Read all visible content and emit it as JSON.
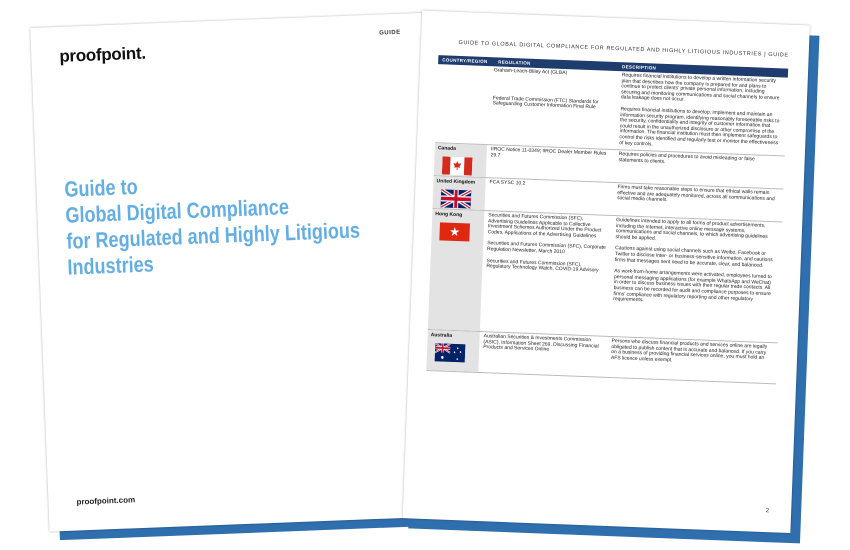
{
  "cover": {
    "logo": "proofpoint.",
    "label": "GUIDE",
    "title_lines": [
      "Guide to",
      "Global Digital Compliance",
      "for Regulated and Highly Litigious",
      "Industries"
    ],
    "url": "proofpoint.com"
  },
  "page": {
    "header": "GUIDE TO GLOBAL DIGITAL COMPLIANCE FOR REGULATED AND HIGHLY LITIGIOUS INDUSTRIES  |  GUIDE",
    "columns": [
      "COUNTRY/REGION",
      "REGULATION",
      "DESCRIPTION"
    ],
    "page_number": "2",
    "rows": [
      {
        "country": "",
        "regulations": [
          "Graham-Leach-Bliley Act (GLBA)",
          "Federal Trade Commission (FTC) Standards for Safeguarding Customer Information Final Rule"
        ],
        "descriptions": [
          "Requires financial institutions to develop a written information security plan that describes how the company is prepared for and plans to continue to protect clients' private personal information, including securing and monitoring communications and social channels to ensure data leakage does not occur.",
          "Requires financial institutions to develop, implement and maintain an information security program, identifying reasonably foreseeable risks to the security, confidentiality and integrity of customer information that could result in the unauthorized disclosure or other compromise of the information. The financial institution must then implement safeguards to control the risks identified and regularly test or monitor the effectiveness of key controls."
        ]
      },
      {
        "country": "Canada",
        "regulations": [
          "IIROC Notice 11-0349; IIROC Dealer Member Rules 29.7"
        ],
        "descriptions": [
          "Requires policies and procedures to avoid misleading or false statements to clients."
        ]
      },
      {
        "country": "United Kingdom",
        "regulations": [
          "FCA SYSC 10.2"
        ],
        "descriptions": [
          "Firms must take reasonable steps to ensure that ethical walls remain effective and are adequately monitored, across all communications and social media channels."
        ]
      },
      {
        "country": "Hong Kong",
        "regulations": [
          "Securities and Futures Commission (SFC), Advertising Guidelines Applicable to Collective Investment Schemes Authorized Under the Product Codes, Applications of the Advertising Guidelines",
          "Securities and Futures Commission (SFC), Corporate Regulation Newsletter, March 2010",
          "Securities and Futures Commission (SFC), Regulatory Technology Watch, COVID-19 Advisory"
        ],
        "descriptions": [
          "Guidelines intended to apply to all forms of product advertisements, including the Internet, interactive online message systems, communications and social channels, to which advertising guidelines should be applied.",
          "Cautions against using social channels such as Weibo, Facebook or Twitter to disclose inter- or business-sensitive information, and cautions firms that messages sent need to be accurate, clear, and balanced.",
          "As work-from-home arrangements were activated, employees turned to personal messaging applications (for example WhatsApp and WeChat) in order to discuss business issues with their regular trade contacts. All business can be recorded for audit and compliance purposes to ensure firms' compliance with regulatory reporting and other regulatory requirements."
        ]
      },
      {
        "country": "Australia",
        "regulations": [
          "Australian Securities & Investments Commission (ASIC), Information Sheet 269, Discussing Financial Products and Services Online"
        ],
        "descriptions": [
          "Persons who discuss financial products and services online are legally obligated to publish content that is accurate and balanced. If you carry on a business of providing financial services online, you must hold an AFS licence unless exempt."
        ]
      }
    ]
  }
}
